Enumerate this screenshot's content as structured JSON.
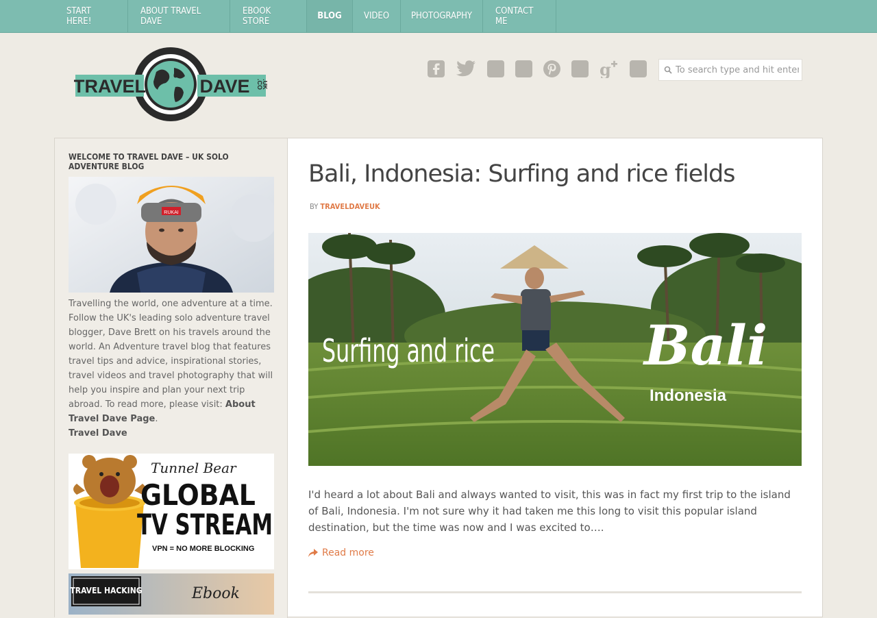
{
  "nav": {
    "items": [
      {
        "label": "START HERE!"
      },
      {
        "label": "ABOUT TRAVEL DAVE"
      },
      {
        "label": "EBOOK STORE"
      },
      {
        "label": "BLOG"
      },
      {
        "label": "VIDEO"
      },
      {
        "label": "PHOTOGRAPHY"
      },
      {
        "label": "CONTACT ME"
      }
    ],
    "active": "BLOG"
  },
  "logo": {
    "left_text": "TRAVEL",
    "right_text": "DAVE",
    "suffix_top": ".CO",
    "suffix_bottom": ".UK"
  },
  "social_icons": [
    "facebook-icon",
    "twitter-icon",
    "square-icon",
    "square-icon",
    "pinterest-icon",
    "square-icon",
    "google-plus-icon",
    "square-icon"
  ],
  "search": {
    "placeholder": "To search type and hit enter"
  },
  "sidebar": {
    "widget_title": "WELCOME TO TRAVEL DAVE – UK SOLO ADVENTURE BLOG",
    "about_text": "Travelling the world, one adventure at a time. Follow the UK's leading solo adventure travel blogger, Dave Brett on his travels around the world. An Adventure travel blog that features travel tips and advice, inspirational stories, travel videos and travel photography that will help you inspire and plan your next trip abroad. To read more, please visit: ",
    "about_link": "About Travel Dave Page",
    "about_suffix": ".",
    "signature": "Travel Dave",
    "portrait_badge": "RUKAI",
    "ad1": {
      "brand": "Tunnel Bear",
      "line1": "GLOBAL",
      "line2": "TV STREAM",
      "tagline": "VPN = NO MORE BLOCKING"
    },
    "ad2": {
      "badge": "TRAVEL HACKING",
      "script": "Ebook"
    }
  },
  "post": {
    "title": "Bali, Indonesia: Surfing and rice fields",
    "by_label": "BY",
    "author": "TRAVELDAVEUK",
    "hero": {
      "left_text": "Surfing and rice",
      "right_big": "Bali",
      "right_small": "Indonesia"
    },
    "excerpt": "I'd heard a lot about Bali and always wanted to visit, this was in fact my first trip to the island of Bali, Indonesia. I'm not sure why it had taken me this long to visit this popular island destination, but the time was now and I was excited to….",
    "read_more": "Read more"
  },
  "colors": {
    "nav_bg": "#7dbcb0",
    "accent": "#e07b48",
    "page_bg": "#eeebe4",
    "sidebar_bg": "#f0ede7",
    "logo_teal": "#6dbfa9"
  }
}
